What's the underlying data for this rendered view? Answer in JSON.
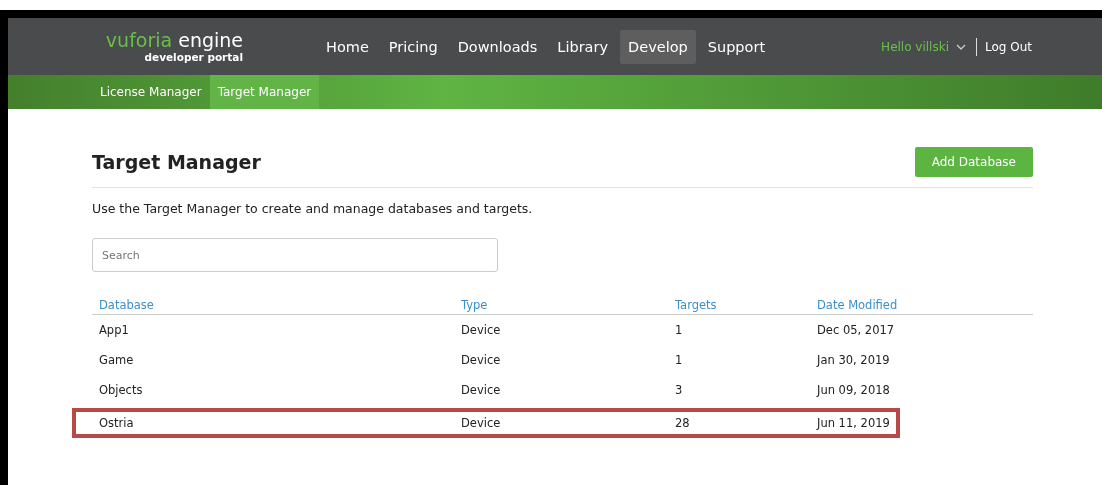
{
  "logo": {
    "brand": "vuforia",
    "product": "engine",
    "subtitle": "developer portal"
  },
  "nav": [
    {
      "label": "Home",
      "selected": false
    },
    {
      "label": "Pricing",
      "selected": false
    },
    {
      "label": "Downloads",
      "selected": false
    },
    {
      "label": "Library",
      "selected": false
    },
    {
      "label": "Develop",
      "selected": true
    },
    {
      "label": "Support",
      "selected": false
    }
  ],
  "user": {
    "greeting": "Hello villski",
    "logout": "Log Out"
  },
  "subnav": [
    {
      "label": "License Manager",
      "selected": false
    },
    {
      "label": "Target Manager",
      "selected": true
    }
  ],
  "page": {
    "title": "Target Manager",
    "add_button": "Add Database",
    "description": "Use the Target Manager to create and manage databases and targets.",
    "search": {
      "placeholder": "Search"
    }
  },
  "table": {
    "columns": [
      "Database",
      "Type",
      "Targets",
      "Date Modified"
    ],
    "rows": [
      {
        "cells": [
          "App1",
          "Device",
          "1",
          "Dec 05, 2017"
        ],
        "highlighted": false
      },
      {
        "cells": [
          "Game",
          "Device",
          "1",
          "Jan 30, 2019"
        ],
        "highlighted": false
      },
      {
        "cells": [
          "Objects",
          "Device",
          "3",
          "Jun 09, 2018"
        ],
        "highlighted": false
      },
      {
        "cells": [
          "Ostria",
          "Device",
          "28",
          "Jun 11, 2019"
        ],
        "highlighted": true
      }
    ]
  }
}
